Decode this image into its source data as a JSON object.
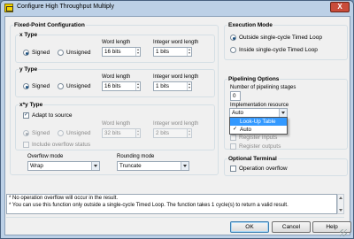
{
  "window": {
    "title": "Configure High Throughput Multiply",
    "close_label": "X",
    "icon": "labview-vi-icon"
  },
  "fixed_point": {
    "title": "Fixed-Point Configuration",
    "x_type": {
      "title": "x Type",
      "signed_label": "Signed",
      "unsigned_label": "Unsigned",
      "selected": "Signed",
      "word_length_label": "Word length",
      "word_length_value": "16 bits",
      "integer_word_length_label": "Integer word length",
      "integer_word_length_value": "1 bits"
    },
    "y_type": {
      "title": "y Type",
      "signed_label": "Signed",
      "unsigned_label": "Unsigned",
      "selected": "Signed",
      "word_length_label": "Word length",
      "word_length_value": "16 bits",
      "integer_word_length_label": "Integer word length",
      "integer_word_length_value": "1 bits"
    },
    "xy_type": {
      "title": "x*y Type",
      "adapt_label": "Adapt to source",
      "adapt_checked": true,
      "signed_label": "Signed",
      "unsigned_label": "Unsigned",
      "selected": "Signed",
      "word_length_label": "Word length",
      "word_length_value": "32 bits",
      "integer_word_length_label": "Integer word length",
      "integer_word_length_value": "2 bits",
      "overflow_status_label": "Include overflow status",
      "overflow_status_checked": false
    },
    "overflow_mode": {
      "label": "Overflow mode",
      "value": "Wrap"
    },
    "rounding_mode": {
      "label": "Rounding mode",
      "value": "Truncate"
    }
  },
  "execution_mode": {
    "title": "Execution Mode",
    "options": [
      "Outside single-cycle Timed Loop",
      "Inside single-cycle Timed Loop"
    ],
    "selected": "Outside single-cycle Timed Loop"
  },
  "pipelining": {
    "title": "Pipelining Options",
    "stages_label": "Number of pipelining stages",
    "stages_value": "0",
    "impl_label": "Implementation resource",
    "impl_value": "Auto",
    "impl_options": [
      {
        "label": "Look-Up Table",
        "highlighted": true,
        "checked": false
      },
      {
        "label": "Auto",
        "highlighted": false,
        "checked": true
      }
    ],
    "check_mark": "✓",
    "register_inputs_label": "Register inputs",
    "register_outputs_label": "Register outputs"
  },
  "optional_terminal": {
    "title": "Optional Terminal",
    "operation_overflow_label": "Operation overflow",
    "checked": false
  },
  "messages": [
    "* No operation overflow will occur in the result.",
    "* You can use this function only outside a single-cycle Timed Loop. The function takes 1 cycle(s) to return a valid result."
  ],
  "buttons": {
    "ok": "OK",
    "cancel": "Cancel",
    "help": "Help"
  },
  "colors": {
    "window_frame": "#bcd0e6",
    "client_bg": "#f0f0f0",
    "highlight": "#3399ff",
    "close_button": "#c94c3a"
  }
}
